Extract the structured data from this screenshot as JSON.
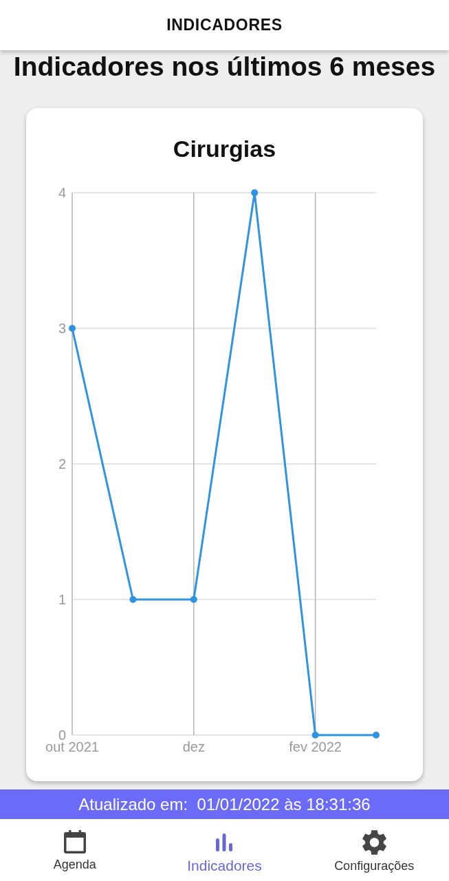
{
  "header": {
    "title": "INDICADORES"
  },
  "page_title": "Indicadores nos últimos 6 meses",
  "chart_card": {
    "chart_data": {
      "type": "line",
      "title": "Cirurgias",
      "categories": [
        "out 2021",
        null,
        "dez",
        null,
        "fev 2022",
        null
      ],
      "series": [
        {
          "color": "#2f93e0",
          "marker": "circle",
          "values": [
            3,
            1,
            1,
            4,
            0,
            0
          ]
        }
      ],
      "ylim": [
        0,
        4
      ],
      "yticks": [
        0,
        1,
        2,
        3,
        4
      ],
      "grid": true
    }
  },
  "status_bar": {
    "text": "Atualizado em:  01/01/2022 às 18:31:36"
  },
  "bottom_nav": [
    {
      "kind": "calendar",
      "label": "Agenda",
      "selected": false
    },
    {
      "kind": "chart",
      "label": "Indicadores",
      "selected": true
    },
    {
      "kind": "settings",
      "label": "Configurações",
      "selected": false
    }
  ]
}
